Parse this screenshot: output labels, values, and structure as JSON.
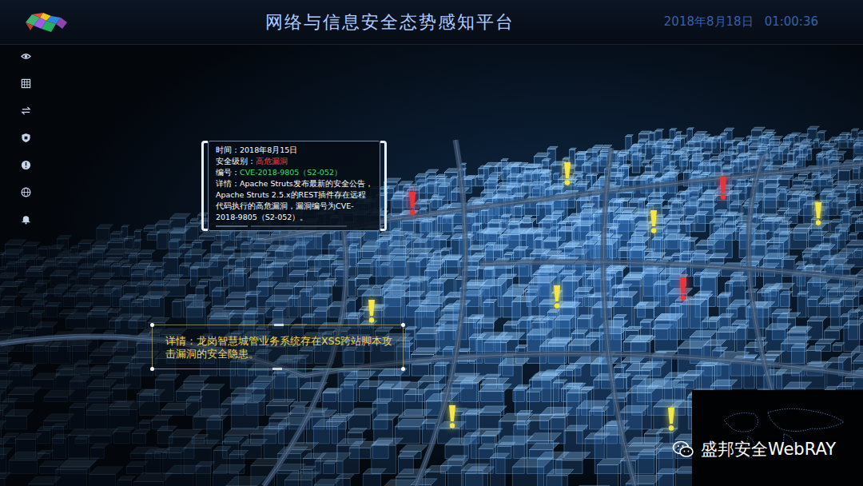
{
  "header": {
    "title": "网络与信息安全态势感知平台",
    "date": "2018年8月18日",
    "time": "01:00:36"
  },
  "alert_popup": {
    "fields": [
      {
        "label": "时间：",
        "value": "2018年8月15日",
        "color": "#ffffff"
      },
      {
        "label": "安全级别：",
        "value": "高危漏洞",
        "color": "#ff3b3b"
      },
      {
        "label": "编号：",
        "value": "CVE-2018-9805（S2-052）",
        "color": "#3ddc6a"
      },
      {
        "label": "详情：",
        "value": "Apache Struts发布最新的安全公告，Apache Struts 2.5.x的REST插件存在远程代码执行的高危漏洞，漏洞编号为CVE-2018-9805（S2-052）。",
        "color": "#ffffff"
      }
    ]
  },
  "detail_callout": {
    "label": "详情：",
    "text": "龙岗智慧城管业务系统存在XSS跨站脚本攻击漏洞的安全隐患。"
  },
  "markers": [
    {
      "color": "#f2e64b"
    },
    {
      "color": "#e8343a"
    },
    {
      "color": "#f2e64b"
    },
    {
      "color": "#e8343a"
    },
    {
      "color": "#f2e64b"
    },
    {
      "color": "#f2e64b"
    },
    {
      "color": "#e8343a"
    },
    {
      "color": "#f2e64b"
    },
    {
      "color": "#f2e64b"
    },
    {
      "color": "#f2e64b"
    }
  ],
  "watermark": {
    "text": "盛邦安全WebRAY"
  }
}
